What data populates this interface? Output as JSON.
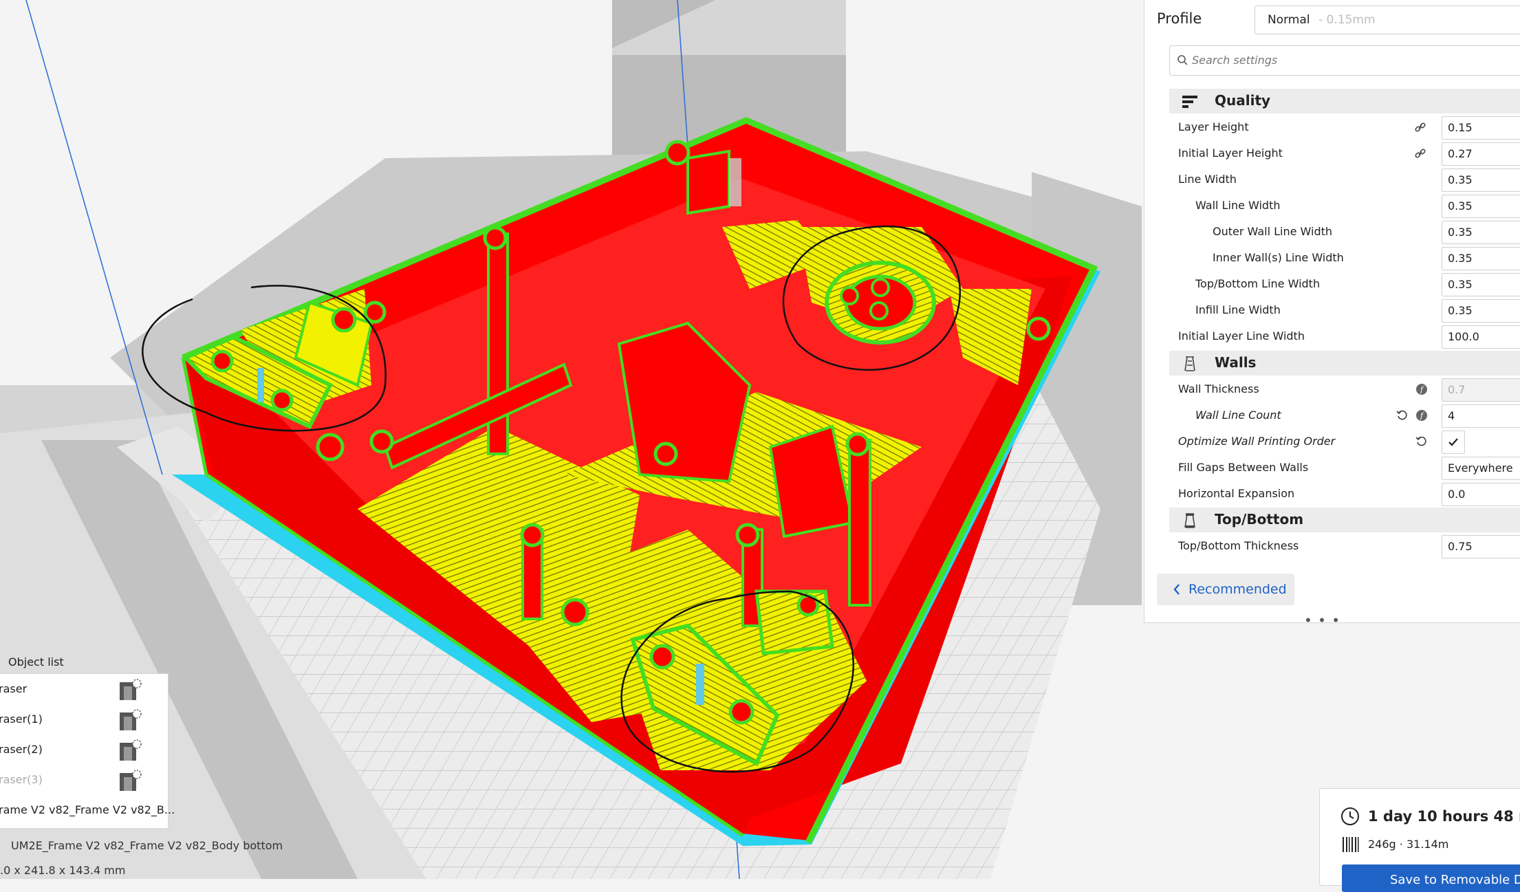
{
  "profile": {
    "label": "Profile",
    "name": "Normal",
    "sub": " - 0.15mm"
  },
  "search": {
    "placeholder": "Search settings"
  },
  "categories": {
    "quality": "Quality",
    "walls": "Walls",
    "topbottom": "Top/Bottom"
  },
  "settings": {
    "layer_height": {
      "label": "Layer Height",
      "value": "0.15"
    },
    "initial_layer_height": {
      "label": "Initial Layer Height",
      "value": "0.27"
    },
    "line_width": {
      "label": "Line Width",
      "value": "0.35"
    },
    "wall_line_width": {
      "label": "Wall Line Width",
      "value": "0.35"
    },
    "outer_wall_line_width": {
      "label": "Outer Wall Line Width",
      "value": "0.35"
    },
    "inner_wall_line_width": {
      "label": "Inner Wall(s) Line Width",
      "value": "0.35"
    },
    "topbottom_line_width": {
      "label": "Top/Bottom Line Width",
      "value": "0.35"
    },
    "infill_line_width": {
      "label": "Infill Line Width",
      "value": "0.35"
    },
    "initial_layer_line_width": {
      "label": "Initial Layer Line Width",
      "value": "100.0"
    },
    "wall_thickness": {
      "label": "Wall Thickness",
      "value": "0.7"
    },
    "wall_line_count": {
      "label": "Wall Line Count",
      "value": "4"
    },
    "optimize_wall_order": {
      "label": "Optimize Wall Printing Order",
      "checked": true
    },
    "fill_gaps": {
      "label": "Fill Gaps Between Walls",
      "value": "Everywhere"
    },
    "horizontal_expansion": {
      "label": "Horizontal Expansion",
      "value": "0.0"
    },
    "topbottom_thickness": {
      "label": "Top/Bottom Thickness",
      "value": "0.75"
    }
  },
  "recommended_label": "Recommended",
  "object_list": {
    "title": "Object list",
    "items": [
      "raser",
      "raser(1)",
      "raser(2)",
      "raser(3)",
      "rame V2 v82_Frame V2 v82_B..."
    ]
  },
  "model": {
    "name": "UM2E_Frame V2 v82_Frame V2 v82_Body bottom",
    "dims": ".0 x 241.8 x 143.4 mm"
  },
  "print": {
    "time": "1 day 10 hours 48 minu",
    "material": "246g · 31.14m",
    "save_label": "Save to Removable D"
  },
  "colors": {
    "accent": "#1f63c6",
    "model_red": "#ff0000",
    "infill_yellow": "#f2f200",
    "wall_green": "#44dd22",
    "support_blue": "#2bd3f0"
  }
}
